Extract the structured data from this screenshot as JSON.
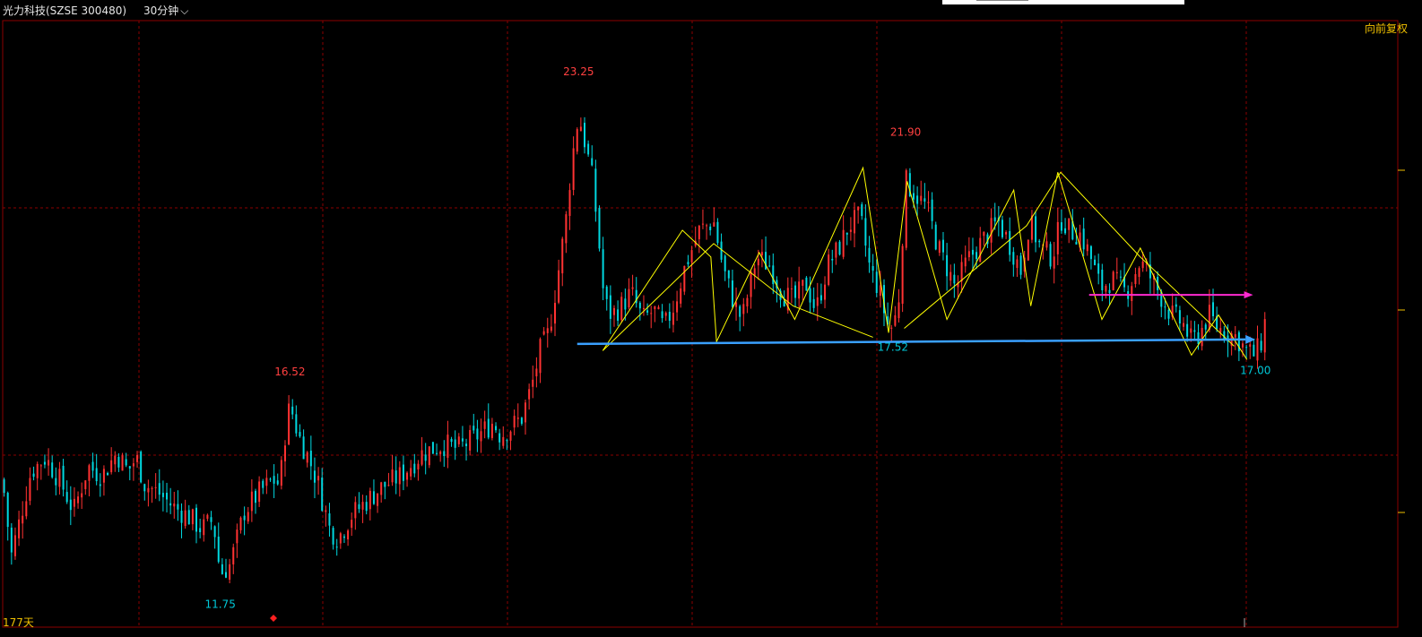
{
  "header": {
    "stock_title": "光力科技(SZSE 300480)",
    "period": "30分钟",
    "adjust_mode": "向前复权",
    "days": "177天"
  },
  "colors": {
    "background": "#000000",
    "grid": "#8b0000",
    "up": "#ff3232",
    "down": "#00d8e0",
    "pattern_lines": "#ffff00",
    "support_line": "#3aa0ff",
    "resistance_arrow": "#ff2ad0",
    "high_label": "#ff4040",
    "low_label": "#00c8d8"
  },
  "chart_data": {
    "type": "candlestick",
    "y_range": [
      11.0,
      24.6
    ],
    "annotations": [
      {
        "label": "23.25",
        "kind": "high",
        "bar": 0.405,
        "value": 23.25
      },
      {
        "label": "21.90",
        "kind": "high",
        "bar": 0.635,
        "value": 21.9
      },
      {
        "label": "16.52",
        "kind": "high",
        "bar": 0.202,
        "value": 16.52
      },
      {
        "label": "17.52",
        "kind": "low",
        "bar": 0.626,
        "value": 17.52
      },
      {
        "label": "17.00",
        "kind": "low",
        "bar": 0.881,
        "value": 17.0
      },
      {
        "label": "11.75",
        "kind": "low",
        "bar": 0.153,
        "value": 11.75
      }
    ],
    "close_path": [
      [
        0.0,
        14.3
      ],
      [
        0.006,
        12.6
      ],
      [
        0.012,
        13.4
      ],
      [
        0.02,
        14.5
      ],
      [
        0.03,
        14.8
      ],
      [
        0.04,
        14.3
      ],
      [
        0.05,
        13.6
      ],
      [
        0.06,
        14.6
      ],
      [
        0.07,
        14.4
      ],
      [
        0.08,
        14.9
      ],
      [
        0.088,
        14.5
      ],
      [
        0.094,
        14.8
      ],
      [
        0.1,
        14.2
      ],
      [
        0.11,
        14.0
      ],
      [
        0.12,
        13.7
      ],
      [
        0.13,
        13.5
      ],
      [
        0.14,
        13.2
      ],
      [
        0.148,
        13.4
      ],
      [
        0.153,
        12.2
      ],
      [
        0.16,
        12.4
      ],
      [
        0.17,
        13.6
      ],
      [
        0.18,
        14.0
      ],
      [
        0.19,
        14.3
      ],
      [
        0.195,
        14.2
      ],
      [
        0.198,
        15.2
      ],
      [
        0.202,
        16.0
      ],
      [
        0.208,
        15.3
      ],
      [
        0.215,
        14.8
      ],
      [
        0.222,
        14.2
      ],
      [
        0.23,
        13.2
      ],
      [
        0.236,
        13.0
      ],
      [
        0.245,
        13.5
      ],
      [
        0.255,
        13.8
      ],
      [
        0.265,
        14.1
      ],
      [
        0.28,
        14.4
      ],
      [
        0.295,
        14.9
      ],
      [
        0.31,
        15.1
      ],
      [
        0.32,
        15.0
      ],
      [
        0.33,
        15.2
      ],
      [
        0.338,
        15.4
      ],
      [
        0.345,
        15.6
      ],
      [
        0.35,
        15.3
      ],
      [
        0.358,
        15.5
      ],
      [
        0.365,
        15.7
      ],
      [
        0.372,
        16.4
      ],
      [
        0.378,
        17.2
      ],
      [
        0.384,
        17.6
      ],
      [
        0.39,
        18.8
      ],
      [
        0.396,
        20.1
      ],
      [
        0.4,
        21.4
      ],
      [
        0.405,
        22.5
      ],
      [
        0.41,
        21.8
      ],
      [
        0.415,
        21.0
      ],
      [
        0.42,
        19.4
      ],
      [
        0.423,
        18.3
      ],
      [
        0.428,
        18.0
      ],
      [
        0.435,
        18.2
      ],
      [
        0.442,
        18.5
      ],
      [
        0.45,
        17.9
      ],
      [
        0.458,
        18.1
      ],
      [
        0.465,
        17.7
      ],
      [
        0.472,
        18.2
      ],
      [
        0.48,
        19.1
      ],
      [
        0.49,
        19.9
      ],
      [
        0.5,
        20.1
      ],
      [
        0.507,
        19.0
      ],
      [
        0.515,
        18.2
      ],
      [
        0.52,
        17.9
      ],
      [
        0.53,
        19.3
      ],
      [
        0.54,
        19.1
      ],
      [
        0.548,
        18.5
      ],
      [
        0.556,
        18.3
      ],
      [
        0.565,
        18.7
      ],
      [
        0.572,
        18.1
      ],
      [
        0.58,
        19.1
      ],
      [
        0.588,
        19.5
      ],
      [
        0.595,
        20.0
      ],
      [
        0.603,
        20.2
      ],
      [
        0.61,
        19.0
      ],
      [
        0.616,
        18.6
      ],
      [
        0.622,
        17.8
      ],
      [
        0.626,
        17.7
      ],
      [
        0.63,
        18.3
      ],
      [
        0.635,
        21.0
      ],
      [
        0.642,
        20.7
      ],
      [
        0.65,
        20.4
      ],
      [
        0.658,
        19.5
      ],
      [
        0.665,
        19.0
      ],
      [
        0.67,
        18.6
      ],
      [
        0.678,
        19.2
      ],
      [
        0.69,
        19.7
      ],
      [
        0.7,
        20.1
      ],
      [
        0.708,
        19.6
      ],
      [
        0.716,
        19.0
      ],
      [
        0.722,
        20.1
      ],
      [
        0.73,
        19.5
      ],
      [
        0.738,
        19.3
      ],
      [
        0.745,
        20.2
      ],
      [
        0.75,
        19.9
      ],
      [
        0.758,
        19.8
      ],
      [
        0.765,
        19.3
      ],
      [
        0.772,
        18.6
      ],
      [
        0.78,
        18.8
      ],
      [
        0.79,
        18.5
      ],
      [
        0.8,
        19.2
      ],
      [
        0.808,
        18.8
      ],
      [
        0.815,
        18.4
      ],
      [
        0.822,
        18.0
      ],
      [
        0.83,
        17.8
      ],
      [
        0.836,
        17.4
      ],
      [
        0.842,
        17.6
      ],
      [
        0.848,
        18.0
      ],
      [
        0.855,
        17.7
      ],
      [
        0.862,
        17.6
      ],
      [
        0.868,
        17.5
      ],
      [
        0.874,
        17.2
      ],
      [
        0.881,
        17.1
      ],
      [
        0.885,
        17.4
      ],
      [
        0.888,
        17.9
      ]
    ]
  }
}
